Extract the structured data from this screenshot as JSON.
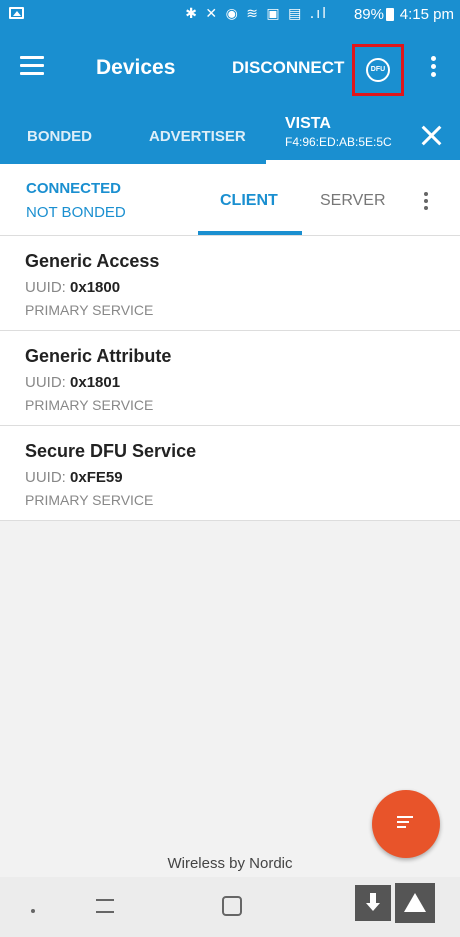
{
  "status_bar": {
    "icons": "✱ ✕ ◉ ≋ ▣ ▤ .ıl",
    "battery": "89%",
    "time": "4:15 pm"
  },
  "app_bar": {
    "title": "Devices",
    "disconnect_label": "DISCONNECT",
    "dfu_label": "DFU"
  },
  "tabs": {
    "bonded": "BONDED",
    "advertiser": "ADVERTISER",
    "device_name": "VISTA",
    "device_mac": "F4:96:ED:AB:5E:5C"
  },
  "connection": {
    "status": "CONNECTED",
    "bond": "NOT BONDED",
    "client_tab": "CLIENT",
    "server_tab": "SERVER"
  },
  "services": [
    {
      "name": "Generic Access",
      "uuid_label": "UUID:",
      "uuid": "0x1800",
      "type": "PRIMARY SERVICE"
    },
    {
      "name": "Generic Attribute",
      "uuid_label": "UUID:",
      "uuid": "0x1801",
      "type": "PRIMARY SERVICE"
    },
    {
      "name": "Secure DFU Service",
      "uuid_label": "UUID:",
      "uuid": "0xFE59",
      "type": "PRIMARY SERVICE"
    }
  ],
  "footer": "Wireless by Nordic",
  "colors": {
    "primary": "#1a8fd0",
    "fab": "#e8542a",
    "highlight_box": "#e0151b"
  }
}
